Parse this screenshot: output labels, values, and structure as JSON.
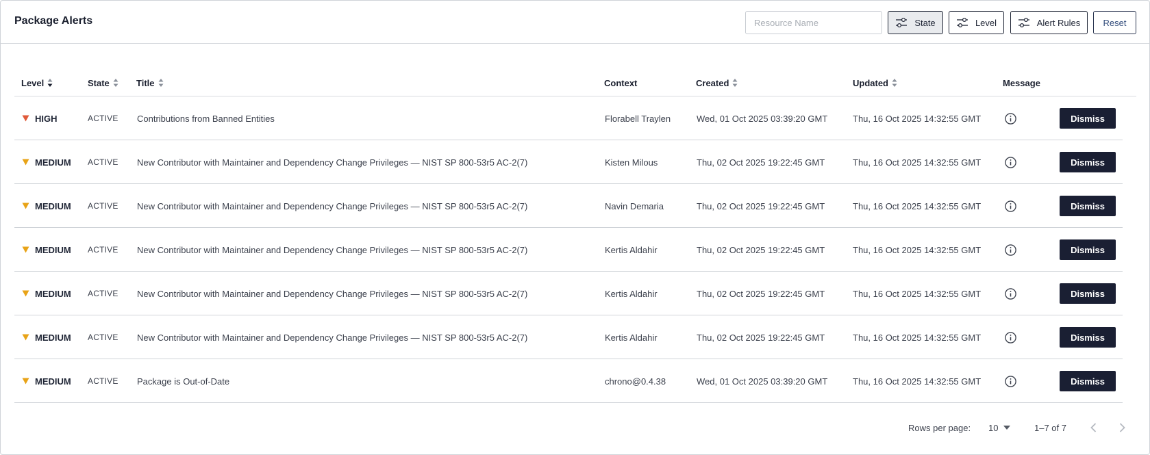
{
  "header": {
    "title": "Package Alerts",
    "search_placeholder": "Resource Name",
    "filters": {
      "state": "State",
      "level": "Level",
      "alert_rules": "Alert Rules",
      "reset": "Reset"
    }
  },
  "table": {
    "columns": {
      "level": "Level",
      "state": "State",
      "title": "Title",
      "context": "Context",
      "created": "Created",
      "updated": "Updated",
      "message": "Message"
    },
    "dismiss_label": "Dismiss",
    "rows": [
      {
        "level": "HIGH",
        "state": "ACTIVE",
        "title": "Contributions from Banned Entities",
        "context": "Florabell Traylen",
        "created": "Wed, 01 Oct 2025 03:39:20 GMT",
        "updated": "Thu, 16 Oct 2025 14:32:55 GMT"
      },
      {
        "level": "MEDIUM",
        "state": "ACTIVE",
        "title": "New Contributor with Maintainer and Dependency Change Privileges — NIST SP 800-53r5 AC-2(7)",
        "context": "Kisten Milous",
        "created": "Thu, 02 Oct 2025 19:22:45 GMT",
        "updated": "Thu, 16 Oct 2025 14:32:55 GMT"
      },
      {
        "level": "MEDIUM",
        "state": "ACTIVE",
        "title": "New Contributor with Maintainer and Dependency Change Privileges — NIST SP 800-53r5 AC-2(7)",
        "context": "Navin Demaria",
        "created": "Thu, 02 Oct 2025 19:22:45 GMT",
        "updated": "Thu, 16 Oct 2025 14:32:55 GMT"
      },
      {
        "level": "MEDIUM",
        "state": "ACTIVE",
        "title": "New Contributor with Maintainer and Dependency Change Privileges — NIST SP 800-53r5 AC-2(7)",
        "context": "Kertis Aldahir",
        "created": "Thu, 02 Oct 2025 19:22:45 GMT",
        "updated": "Thu, 16 Oct 2025 14:32:55 GMT"
      },
      {
        "level": "MEDIUM",
        "state": "ACTIVE",
        "title": "New Contributor with Maintainer and Dependency Change Privileges — NIST SP 800-53r5 AC-2(7)",
        "context": "Kertis Aldahir",
        "created": "Thu, 02 Oct 2025 19:22:45 GMT",
        "updated": "Thu, 16 Oct 2025 14:32:55 GMT"
      },
      {
        "level": "MEDIUM",
        "state": "ACTIVE",
        "title": "New Contributor with Maintainer and Dependency Change Privileges — NIST SP 800-53r5 AC-2(7)",
        "context": "Kertis Aldahir",
        "created": "Thu, 02 Oct 2025 19:22:45 GMT",
        "updated": "Thu, 16 Oct 2025 14:32:55 GMT"
      },
      {
        "level": "MEDIUM",
        "state": "ACTIVE",
        "title": "Package is Out-of-Date",
        "context": "chrono@0.4.38",
        "created": "Wed, 01 Oct 2025 03:39:20 GMT",
        "updated": "Thu, 16 Oct 2025 14:32:55 GMT"
      }
    ]
  },
  "pagination": {
    "rows_per_page_label": "Rows per page:",
    "rows_per_page_value": "10",
    "range": "1–7 of 7"
  },
  "colors": {
    "high": "#e05a3a",
    "medium": "#e8a317",
    "dismiss_bg": "#1a1f33"
  },
  "icons": {
    "filter": "filter-sliders-icon",
    "sort": "sort-arrows-icon",
    "info": "info-circle-icon",
    "prev": "chevron-left-icon",
    "next": "chevron-right-icon"
  }
}
